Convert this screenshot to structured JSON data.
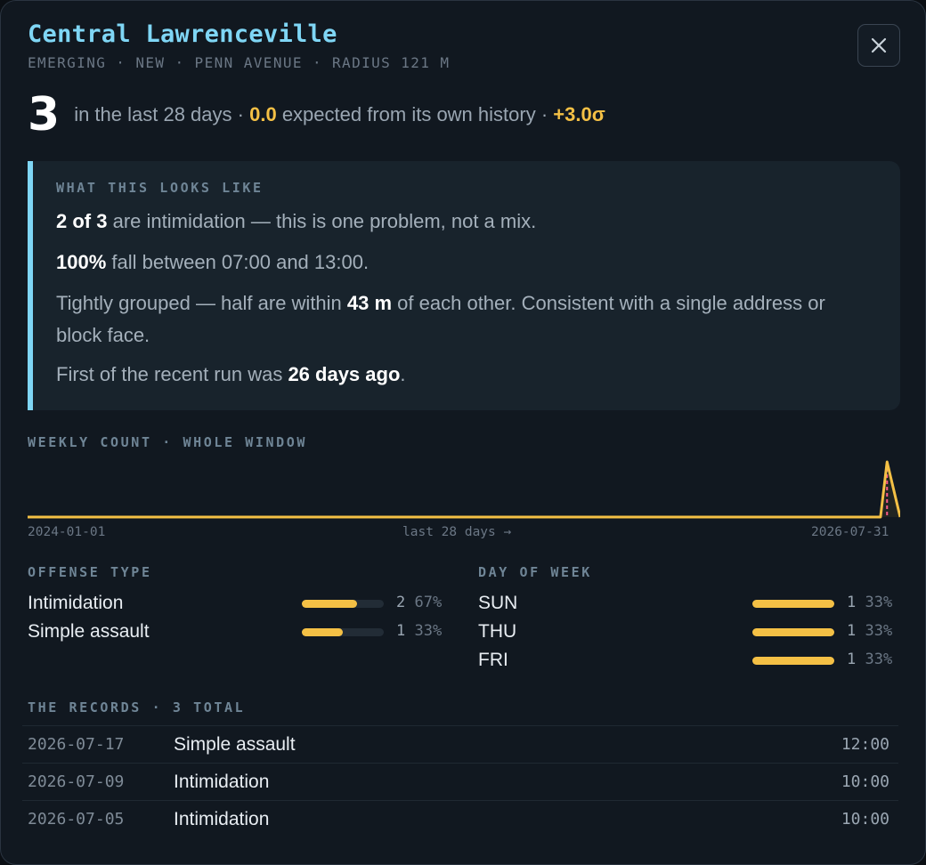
{
  "header": {
    "title": "Central Lawrenceville",
    "subtitle": "EMERGING · NEW · PENN AVENUE · RADIUS 121 M",
    "close_icon": "close-icon"
  },
  "summary": {
    "count": "3",
    "count_text": "in the last 28 days ·",
    "expected": "0.0",
    "expected_text": "expected from its own history ·",
    "sigma": "+3.0σ"
  },
  "insight": {
    "label": "WHAT THIS LOOKS LIKE",
    "line1": {
      "strong": "2 of 3",
      "rest": " are intimidation — this is one problem, not a mix."
    },
    "line2": {
      "strong": "100%",
      "rest": " fall between 07:00 and 13:00."
    },
    "line3": {
      "pre": "Tightly grouped — half are within ",
      "strong": "43 m",
      "rest": " of each other. Consistent with a single address or block face."
    },
    "line4": {
      "pre": "First of the recent run was ",
      "strong": "26 days ago",
      "rest": "."
    }
  },
  "weekly": {
    "label": "WEEKLY COUNT · WHOLE WINDOW",
    "axis_start": "2024-01-01",
    "axis_mid": "last 28 days →",
    "axis_end": "2026-07-31"
  },
  "chart_data": {
    "type": "line",
    "x_start": "2024-01-01",
    "x_end": "2026-07-31",
    "values": [
      0,
      0,
      0,
      0,
      0,
      0,
      0,
      0,
      0,
      0,
      0,
      0,
      0,
      0,
      0,
      0,
      0,
      0,
      0,
      0,
      0,
      0,
      0,
      0,
      0,
      0,
      0,
      0,
      0,
      0,
      0,
      0,
      0,
      0,
      0,
      0,
      0,
      0,
      0,
      0,
      0,
      0,
      0,
      0,
      0,
      0,
      0,
      0,
      0,
      0,
      0,
      0,
      0,
      0,
      0,
      0,
      0,
      0,
      0,
      0,
      0,
      0,
      0,
      0,
      0,
      0,
      0,
      0,
      0,
      0,
      0,
      0,
      0,
      0,
      0,
      0,
      0,
      0,
      0,
      0,
      0,
      0,
      0,
      0,
      0,
      0,
      0,
      0,
      0,
      0,
      0,
      0,
      0,
      0,
      0,
      0,
      0,
      0,
      0,
      0,
      0,
      0,
      0,
      0,
      0,
      0,
      0,
      0,
      0,
      0,
      0,
      0,
      0,
      0,
      0,
      0,
      0,
      0,
      0,
      0,
      0,
      0,
      0,
      0,
      0,
      0,
      0,
      0,
      0,
      0,
      0,
      2,
      1,
      0
    ],
    "marker_index": 131,
    "line_color": "#f4c045",
    "marker_color": "#ff5c8a"
  },
  "offense": {
    "label": "OFFENSE TYPE",
    "items": [
      {
        "name": "Intimidation",
        "count": "2",
        "pct": "67%",
        "fraction": 0.67
      },
      {
        "name": "Simple assault",
        "count": "1",
        "pct": "33%",
        "fraction": 0.5
      }
    ]
  },
  "dow": {
    "label": "DAY OF WEEK",
    "items": [
      {
        "name": "SUN",
        "count": "1",
        "pct": "33%",
        "fraction": 1.0
      },
      {
        "name": "THU",
        "count": "1",
        "pct": "33%",
        "fraction": 1.0
      },
      {
        "name": "FRI",
        "count": "1",
        "pct": "33%",
        "fraction": 1.0
      }
    ]
  },
  "records": {
    "label": "THE RECORDS · 3 TOTAL",
    "rows": [
      {
        "date": "2026-07-17",
        "type": "Simple assault",
        "time": "12:00"
      },
      {
        "date": "2026-07-09",
        "type": "Intimidation",
        "time": "10:00"
      },
      {
        "date": "2026-07-05",
        "type": "Intimidation",
        "time": "10:00"
      }
    ]
  },
  "colors": {
    "accent": "#7fd6f5",
    "highlight": "#f4c045",
    "marker": "#ff5c8a"
  }
}
